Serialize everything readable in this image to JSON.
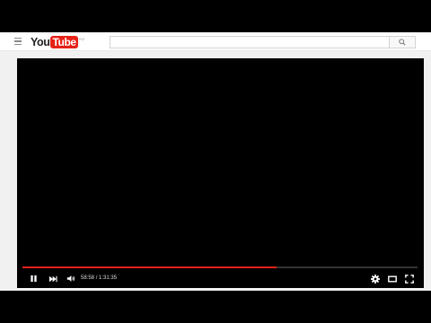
{
  "brand": {
    "logo_you": "You",
    "logo_tube": "Tube",
    "region": "AU"
  },
  "search": {
    "placeholder": "",
    "value": ""
  },
  "player": {
    "current_time": "58:58",
    "time_separator": "/",
    "duration": "1:31:35",
    "progress_fraction": 0.644,
    "buffered_fraction": 0.644,
    "state": "playing"
  },
  "icons": {
    "guide": "hamburger-menu-icon",
    "search": "magnifier-icon",
    "pause": "pause-icon",
    "next": "next-icon",
    "volume": "speaker-icon",
    "settings": "gear-icon",
    "theater": "theater-mode-icon",
    "fullscreen": "fullscreen-icon"
  },
  "colors": {
    "brand_red": "#e62117",
    "progress_red": "#e62117",
    "player_bg": "#000000",
    "page_bg": "#f1f1f1"
  }
}
